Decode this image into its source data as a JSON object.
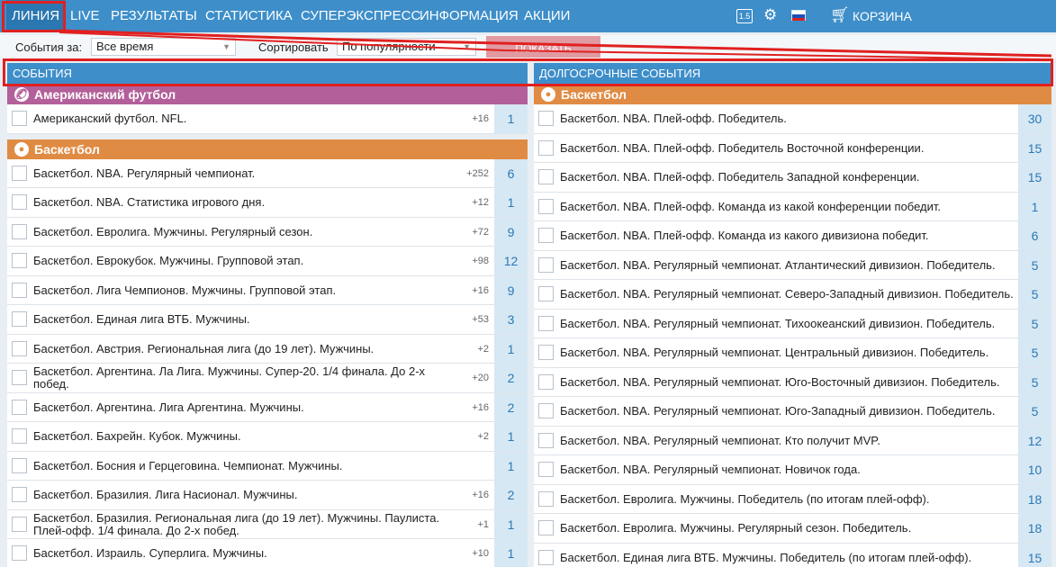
{
  "nav": {
    "items": [
      "ЛИНИЯ",
      "LIVE",
      "РЕЗУЛЬТАТЫ",
      "СТАТИСТИКА",
      "СУПЕРЭКСПРЕСС",
      "ИНФОРМАЦИЯ",
      "АКЦИИ"
    ],
    "odds_format_badge": "1.5",
    "cart_label": "КОРЗИНА"
  },
  "filters": {
    "events_for_label": "События за:",
    "events_for_value": "Все время",
    "sort_label": "Сортировать",
    "sort_value": "По популярности",
    "show_button": "ПОКАЗАТЬ"
  },
  "left": {
    "header": "СОБЫТИЯ",
    "sections": [
      {
        "sport": "Американский футбол",
        "rows": [
          {
            "title": "Американский футбол. NFL.",
            "plus": "+16",
            "count": "1"
          }
        ]
      },
      {
        "sport": "Баскетбол",
        "rows": [
          {
            "title": "Баскетбол. NBA. Регулярный чемпионат.",
            "plus": "+252",
            "count": "6"
          },
          {
            "title": "Баскетбол. NBA. Статистика игрового дня.",
            "plus": "+12",
            "count": "1"
          },
          {
            "title": "Баскетбол. Евролига. Мужчины. Регулярный сезон.",
            "plus": "+72",
            "count": "9"
          },
          {
            "title": "Баскетбол. Еврокубок. Мужчины. Групповой этап.",
            "plus": "+98",
            "count": "12"
          },
          {
            "title": "Баскетбол. Лига Чемпионов. Мужчины. Групповой этап.",
            "plus": "+16",
            "count": "9"
          },
          {
            "title": "Баскетбол. Единая лига ВТБ. Мужчины.",
            "plus": "+53",
            "count": "3"
          },
          {
            "title": "Баскетбол. Австрия. Региональная лига (до 19 лет). Мужчины.",
            "plus": "+2",
            "count": "1"
          },
          {
            "title": "Баскетбол. Аргентина. Ла Лига. Мужчины. Супер-20. 1/4 финала. До 2-х побед.",
            "plus": "+20",
            "count": "2"
          },
          {
            "title": "Баскетбол. Аргентина. Лига Аргентина. Мужчины.",
            "plus": "+16",
            "count": "2"
          },
          {
            "title": "Баскетбол. Бахрейн. Кубок. Мужчины.",
            "plus": "+2",
            "count": "1"
          },
          {
            "title": "Баскетбол. Босния и Герцеговина. Чемпионат. Мужчины.",
            "plus": "",
            "count": "1"
          },
          {
            "title": "Баскетбол. Бразилия. Лига Насионал. Мужчины.",
            "plus": "+16",
            "count": "2"
          },
          {
            "title": "Баскетбол. Бразилия. Региональная лига (до 19 лет). Мужчины. Паулиста. Плей-офф. 1/4 финала. До 2-х побед.",
            "plus": "+1",
            "count": "1"
          },
          {
            "title": "Баскетбол. Израиль. Суперлига. Мужчины.",
            "plus": "+10",
            "count": "1"
          }
        ]
      }
    ]
  },
  "right": {
    "header": "ДОЛГОСРОЧНЫЕ СОБЫТИЯ",
    "sections": [
      {
        "sport": "Баскетбол",
        "rows": [
          {
            "title": "Баскетбол. NBA. Плей-офф. Победитель.",
            "count": "30"
          },
          {
            "title": "Баскетбол. NBA. Плей-офф. Победитель Восточной конференции.",
            "count": "15"
          },
          {
            "title": "Баскетбол. NBA. Плей-офф. Победитель Западной конференции.",
            "count": "15"
          },
          {
            "title": "Баскетбол. NBA. Плей-офф. Команда из какой конференции победит.",
            "count": "1"
          },
          {
            "title": "Баскетбол. NBA. Плей-офф. Команда из какого дивизиона победит.",
            "count": "6"
          },
          {
            "title": "Баскетбол. NBA. Регулярный чемпионат. Атлантический дивизион. Победитель.",
            "count": "5"
          },
          {
            "title": "Баскетбол. NBA. Регулярный чемпионат. Северо-Западный дивизион. Победитель.",
            "count": "5"
          },
          {
            "title": "Баскетбол. NBA. Регулярный чемпионат. Тихоокеанский дивизион. Победитель.",
            "count": "5"
          },
          {
            "title": "Баскетбол. NBA. Регулярный чемпионат. Центральный дивизион. Победитель.",
            "count": "5"
          },
          {
            "title": "Баскетбол. NBA. Регулярный чемпионат. Юго-Восточный дивизион. Победитель.",
            "count": "5"
          },
          {
            "title": "Баскетбол. NBA. Регулярный чемпионат. Юго-Западный дивизион. Победитель.",
            "count": "5"
          },
          {
            "title": "Баскетбол. NBA. Регулярный чемпионат. Кто получит MVP.",
            "count": "12"
          },
          {
            "title": "Баскетбол. NBA. Регулярный чемпионат. Новичок года.",
            "count": "10"
          },
          {
            "title": "Баскетбол. Евролига. Мужчины. Победитель (по итогам плей-офф).",
            "count": "18"
          },
          {
            "title": "Баскетбол. Евролига. Мужчины. Регулярный сезон. Победитель.",
            "count": "18"
          },
          {
            "title": "Баскетбол. Единая лига ВТБ. Мужчины. Победитель (по итогам плей-офф).",
            "count": "15"
          }
        ]
      }
    ]
  },
  "colors": {
    "nav_blue": "#3d8ec9",
    "american_football": "#b35f9a",
    "basketball": "#e08b43",
    "annotation_red": "#e02020"
  }
}
